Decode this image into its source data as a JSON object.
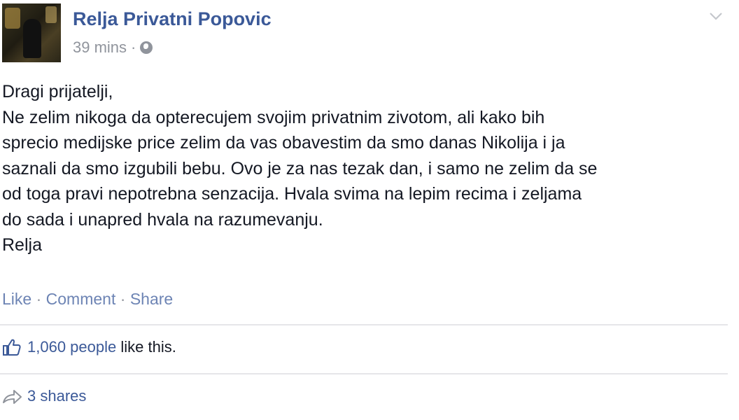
{
  "post": {
    "author": "Relja Privatni Popovic",
    "time": "39 mins",
    "meta_separator": "·",
    "privacy_icon": "globe-icon",
    "menu_icon": "chevron-down-icon",
    "text_lines": [
      "Dragi prijatelji,",
      "Ne zelim nikoga da opterecujem svojim privatnim zivotom, ali kako bih",
      "sprecio medijske price zelim da vas obavestim da smo danas Nikolija i ja",
      "saznali da smo izgubili bebu. Ovo je za nas tezak dan, i samo ne zelim da se",
      "od toga pravi nepotrebna senzacija. Hvala svima na lepim recima i zeljama",
      "do sada i unapred hvala na razumevanju.",
      "Relja"
    ]
  },
  "actions": {
    "like": "Like",
    "comment": "Comment",
    "share": "Share",
    "separator": " · "
  },
  "stats": {
    "likes_count": "1,060 people",
    "likes_suffix": " like this.",
    "likes_icon": "thumbs-up-icon",
    "shares": "3 shares",
    "shares_icon": "share-arrow-icon"
  },
  "colors": {
    "link_blue": "#3b5998",
    "action_blue": "#6d84b4",
    "meta_gray": "#90949c",
    "text": "#141823"
  }
}
